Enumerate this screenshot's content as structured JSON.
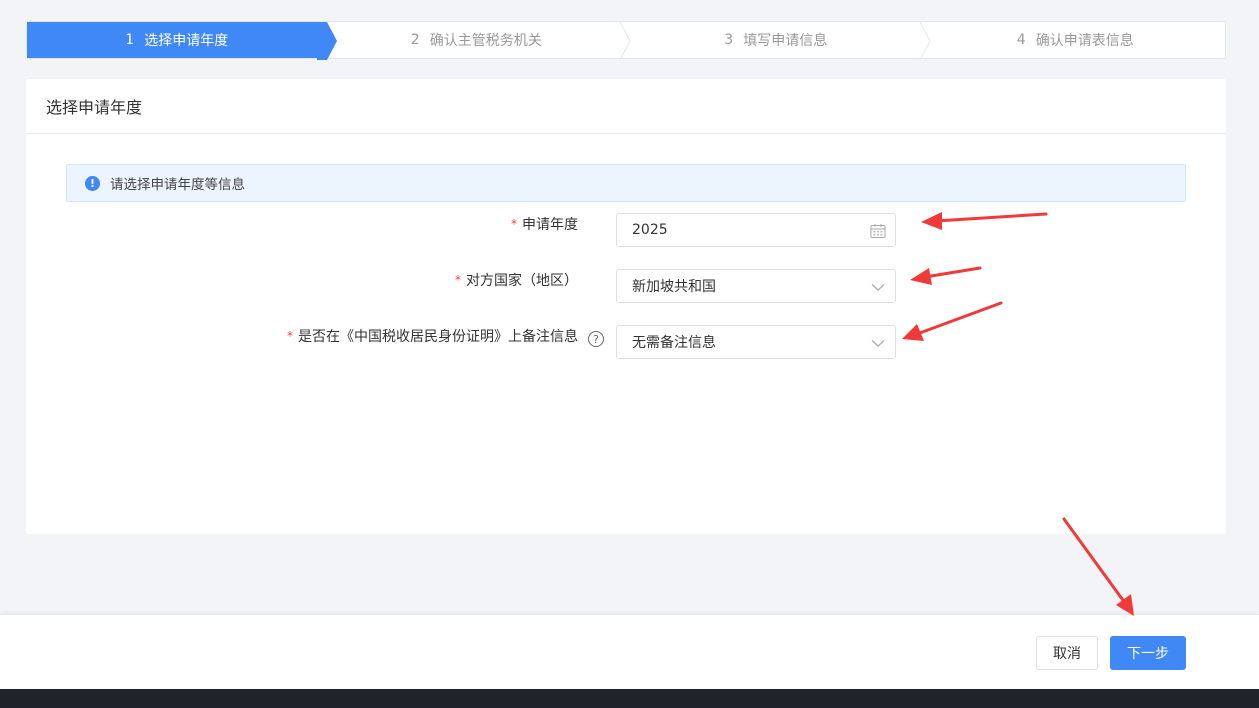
{
  "steps": [
    {
      "num": "1",
      "label": "选择申请年度",
      "active": true
    },
    {
      "num": "2",
      "label": "确认主管税务机关",
      "active": false
    },
    {
      "num": "3",
      "label": "填写申请信息",
      "active": false
    },
    {
      "num": "4",
      "label": "确认申请表信息",
      "active": false
    }
  ],
  "card": {
    "title": "选择申请年度",
    "alert": "请选择申请年度等信息"
  },
  "form": {
    "required_mark": "*",
    "year": {
      "label": "申请年度",
      "value": "2025"
    },
    "country": {
      "label": "对方国家（地区）",
      "value": "新加坡共和国"
    },
    "remark": {
      "label": "是否在《中国税收居民身份证明》上备注信息",
      "value": "无需备注信息",
      "help": "?"
    }
  },
  "footer": {
    "cancel_label": "取消",
    "next_label": "下一步"
  },
  "colors": {
    "primary": "#3f88f5",
    "annotation_arrow": "#f03a3a"
  }
}
